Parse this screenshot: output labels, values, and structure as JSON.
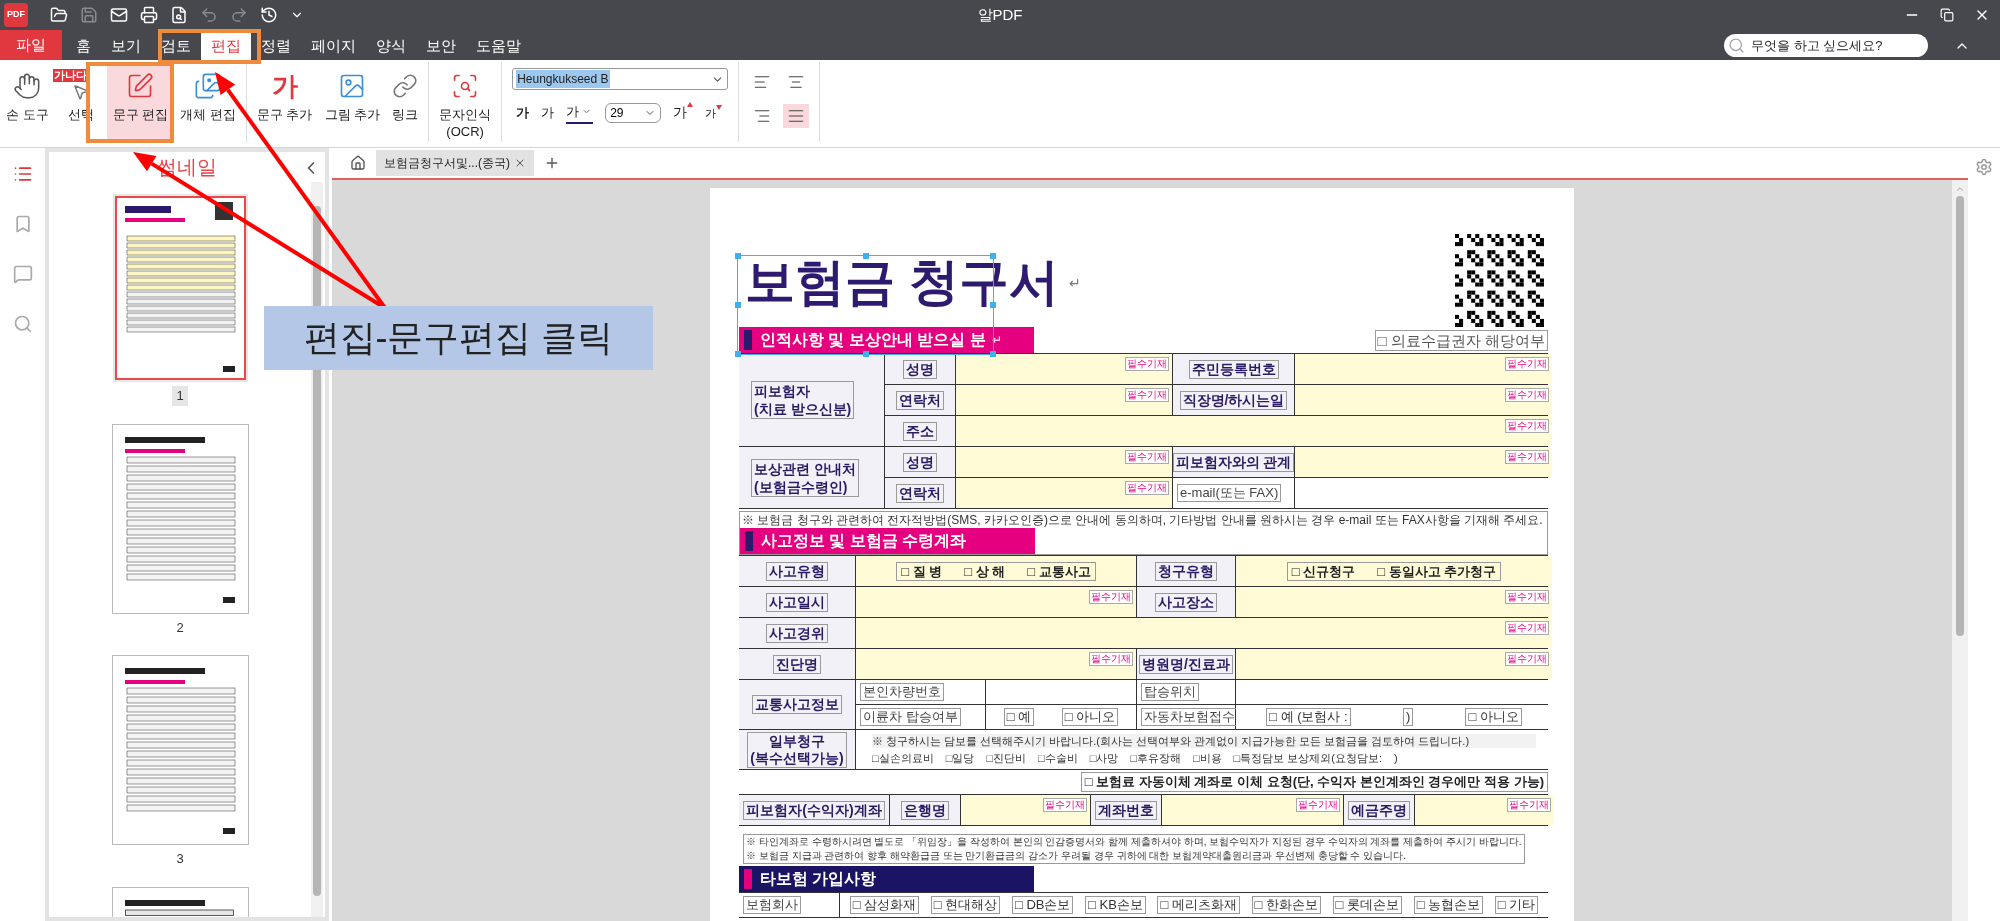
{
  "app": {
    "title": "알PDF",
    "logo": "PDF"
  },
  "quick_access": [
    {
      "kind": "open",
      "disabled": false
    },
    {
      "kind": "save",
      "disabled": true
    },
    {
      "kind": "mail",
      "disabled": false
    },
    {
      "kind": "print",
      "disabled": false
    },
    {
      "kind": "preview",
      "disabled": false
    },
    {
      "kind": "undo",
      "disabled": true
    },
    {
      "kind": "redo",
      "disabled": true
    },
    {
      "kind": "history",
      "disabled": false
    },
    {
      "kind": "more",
      "disabled": false
    }
  ],
  "menu": [
    {
      "kind": "file",
      "label": "파일",
      "selected": false
    },
    {
      "kind": "tab",
      "label": "홈",
      "selected": false
    },
    {
      "kind": "tab",
      "label": "보기",
      "selected": false
    },
    {
      "kind": "tab",
      "label": "검토",
      "selected": false
    },
    {
      "kind": "tab",
      "label": "편집",
      "selected": true
    },
    {
      "kind": "tab",
      "label": "정렬",
      "selected": false
    },
    {
      "kind": "tab",
      "label": "페이지",
      "selected": false
    },
    {
      "kind": "tab",
      "label": "양식",
      "selected": false
    },
    {
      "kind": "tab",
      "label": "보안",
      "selected": false
    },
    {
      "kind": "tab",
      "label": "도움말",
      "selected": false
    }
  ],
  "search": {
    "placeholder": "무엇을 하고 싶으세요?"
  },
  "tools": [
    {
      "kind": "hand",
      "label": "손 도구",
      "selected": false
    },
    {
      "kind": "select",
      "label": "선택",
      "badge": "가나다",
      "selected": false
    },
    {
      "kind": "edit-text",
      "label": "문구 편집",
      "selected": true
    },
    {
      "kind": "edit-object",
      "label": "개체 편집",
      "selected": false
    },
    {
      "kind": "add-text",
      "label": "문구 추가",
      "glyph": "가",
      "selected": false
    },
    {
      "kind": "add-image",
      "label": "그림 추가",
      "selected": false
    },
    {
      "kind": "link",
      "label": "링크",
      "selected": false
    },
    {
      "kind": "ocr",
      "lines": [
        "문자인식",
        "(OCR)"
      ],
      "selected": false
    }
  ],
  "font": {
    "family": "Heungkukseed B",
    "size": "29",
    "styles": [
      {
        "kind": "bold",
        "glyph": "가"
      },
      {
        "kind": "regular",
        "glyph": "가"
      },
      {
        "kind": "color",
        "glyph": "가"
      }
    ],
    "size_buttons": [
      {
        "kind": "grow",
        "glyph": "가"
      },
      {
        "kind": "shrink",
        "glyph": "가"
      }
    ]
  },
  "align": [
    {
      "kind": "left",
      "selected": false
    },
    {
      "kind": "center",
      "selected": false
    },
    {
      "kind": "right",
      "selected": false
    },
    {
      "kind": "justify",
      "selected": true
    }
  ],
  "sidebar_icons": [
    {
      "kind": "thumbnails",
      "selected": true
    },
    {
      "kind": "bookmarks",
      "selected": false
    },
    {
      "kind": "comments",
      "selected": false
    },
    {
      "kind": "search",
      "selected": false
    }
  ],
  "thumbnails": {
    "title": "썸네일",
    "pages": [
      {
        "label": "1",
        "selected": true
      },
      {
        "label": "2",
        "selected": false
      },
      {
        "label": "3",
        "selected": false
      },
      {
        "selected": false
      }
    ]
  },
  "doc_tabs": [
    {
      "label": "보험금청구서및...(종국)",
      "selected": true
    }
  ],
  "document": {
    "title": "보험금 청구서",
    "title_mark": "↵",
    "blocks": [
      {
        "kind": "heading",
        "text": "인적사항 및 보상안내 받으실 분",
        "mark": "↵",
        "color": "#e4007f",
        "marker": {
          "color": "#2b1a6b"
        },
        "aside": "□ 의료수급권자 해당여부"
      },
      {
        "kind": "personal-table",
        "rows": [
          {
            "kind": "field",
            "cells": [
              {
                "kind": "group",
                "lines": [
                  "피보험자",
                  "(치료 받으신분)"
                ],
                "rowspan": 3
              },
              {
                "kind": "label",
                "text": "성명"
              },
              {
                "kind": "input",
                "required": "필수기재"
              },
              {
                "kind": "label",
                "text": "주민등록번호"
              },
              {
                "kind": "input",
                "required": "필수기재"
              }
            ]
          },
          {
            "kind": "field",
            "cells": [
              {
                "kind": "label",
                "text": "연락처"
              },
              {
                "kind": "input",
                "required": "필수기재"
              },
              {
                "kind": "label",
                "text": "직장명/하시는일"
              },
              {
                "kind": "input",
                "required": "필수기재"
              }
            ]
          },
          {
            "kind": "field",
            "cells": [
              {
                "kind": "label",
                "text": "주소"
              },
              {
                "kind": "input",
                "required": "필수기재",
                "colspan": 3
              }
            ]
          },
          {
            "kind": "field",
            "cells": [
              {
                "kind": "group",
                "lines": [
                  "보상관련 안내처",
                  "(보험금수령인)"
                ],
                "rowspan": 2
              },
              {
                "kind": "label",
                "text": "성명"
              },
              {
                "kind": "input",
                "required": "필수기재"
              },
              {
                "kind": "label",
                "text": "피보험자와의 관계"
              },
              {
                "kind": "input",
                "required": "필수기재"
              }
            ]
          },
          {
            "kind": "field",
            "cells": [
              {
                "kind": "label",
                "text": "연락처"
              },
              {
                "kind": "input",
                "required": "필수기재"
              },
              {
                "kind": "hint",
                "text": "e-mail(또는 FAX)"
              },
              {
                "kind": "blank"
              }
            ]
          }
        ]
      },
      {
        "kind": "note",
        "text": "※ 보험금 청구와 관련하여 전자적방법(SMS, 카카오인증)으로 안내에 동의하며, 기타방법 안내를 원하시는 경우 e-mail 또는 FAX사항을 기재해 주세요.",
        "heading": {
          "text": "사고정보 및 보험금 수령계좌",
          "color": "#e4007f",
          "marker": {
            "color": "#2b1a6b"
          }
        }
      },
      {
        "kind": "accident-table",
        "rows": [
          {
            "kind": "field",
            "cells": [
              {
                "kind": "label",
                "text": "사고유형"
              },
              {
                "kind": "options",
                "options": [
                  "□ 질 병",
                  "□ 상 해",
                  "□ 교통사고"
                ],
                "colspan": 2
              },
              {
                "kind": "label",
                "text": "청구유형"
              },
              {
                "kind": "options",
                "options": [
                  "□ 신규청구",
                  "□ 동일사고 추가청구"
                ]
              }
            ]
          },
          {
            "kind": "field",
            "cells": [
              {
                "kind": "label",
                "text": "사고일시"
              },
              {
                "kind": "input",
                "required": "필수기재",
                "colspan": 2
              },
              {
                "kind": "label",
                "text": "사고장소"
              },
              {
                "kind": "input",
                "required": "필수기재"
              }
            ]
          },
          {
            "kind": "field",
            "cells": [
              {
                "kind": "label",
                "text": "사고경위"
              },
              {
                "kind": "input",
                "required": "필수기재",
                "colspan": 4
              }
            ]
          },
          {
            "kind": "field",
            "cells": [
              {
                "kind": "label",
                "text": "진단명"
              },
              {
                "kind": "input",
                "required": "필수기재",
                "colspan": 2
              },
              {
                "kind": "label",
                "text": "병원명/진료과"
              },
              {
                "kind": "input",
                "required": "필수기재"
              }
            ]
          },
          {
            "kind": "sub",
            "cells": [
              {
                "kind": "label",
                "text": "교통사고정보",
                "rowspan": 2
              },
              {
                "kind": "hint",
                "text": "본인차량번호"
              },
              {
                "kind": "blank"
              },
              {
                "kind": "hint",
                "text": "탑승위치"
              },
              {
                "kind": "blank"
              }
            ]
          },
          {
            "kind": "sub",
            "cells": [
              {
                "kind": "hint",
                "text": "이륜차 탑승여부"
              },
              {
                "kind": "choice",
                "options": [
                  "□ 예",
                  "□ 아니오"
                ]
              },
              {
                "kind": "hint",
                "text": "자동차보험접수"
              },
              {
                "kind": "choice",
                "options": [
                  "□ 예 (보험사 :",
                  ")",
                  "□ 아니오"
                ]
              }
            ]
          },
          {
            "kind": "notice",
            "cells": [
              {
                "kind": "label",
                "lines": [
                  "일부청구",
                  "(복수선택가능)"
                ]
              },
              {
                "kind": "notice",
                "colspan": 4,
                "text": "※ 청구하시는 담보를 선택해주시기 바랍니다.(회사는 선택여부와 관계없이 지급가능한 모든 보험금을 검토하여 드립니다.)",
                "options": [
                  "□실손의료비",
                  "□일당",
                  "□진단비",
                  "□수술비",
                  "□사망",
                  "□후유장해",
                  "□비용",
                  "□특정담보 보상제외(요청담보:",
                  ")"
                ]
              }
            ]
          }
        ]
      },
      {
        "kind": "autopay",
        "text": "□ 보험료 자동이체 계좌로 이체 요청(단, 수익자 본인계좌인 경우에만 적용 가능)"
      },
      {
        "kind": "account-table",
        "rows": [
          {
            "kind": "field",
            "cells": [
              {
                "kind": "label",
                "text": "피보험자(수익자)계좌"
              },
              {
                "kind": "label",
                "text": "은행명"
              },
              {
                "kind": "input",
                "required": "필수기재"
              },
              {
                "kind": "label",
                "text": "계좌번호"
              },
              {
                "kind": "input",
                "required": "필수기재"
              },
              {
                "kind": "label",
                "text": "예금주명"
              },
              {
                "kind": "input",
                "required": "필수기재"
              }
            ]
          }
        ]
      },
      {
        "kind": "notes",
        "lines": [
          "※ 타인계좌로 수령하시려면 별도로 「위임장」을 작성하여 본인의 인감증명서와 함께 제출하셔야 하며, 보험수익자가 지정된 경우 수익자의 계좌를 제출하여 주시기 바랍니다.",
          "※ 보험금 지급과 관련하여 향후 해약환급금 또는 만기환급금의 감소가 우려될 경우 귀하에 대한 보험계약대출원리금과 우선변제 충당할 수 있습니다."
        ]
      },
      {
        "kind": "heading",
        "text": "타보험 가입사항",
        "color": "#1b1464",
        "marker": {
          "color": "#e4007f"
        }
      },
      {
        "kind": "other-table",
        "rows": [
          {
            "kind": "sub",
            "cells": [
              {
                "kind": "hint",
                "text": "보험회사"
              },
              {
                "kind": "choice",
                "options": [
                  "□ 삼성화재",
                  "□ 현대해상",
                  "□ DB손보",
                  "□ KB손보",
                  "□ 메리츠화재",
                  "□ 한화손보",
                  "□ 롯데손보",
                  "□ 농협손보",
                  "□ 기타"
                ]
              }
            ]
          }
        ]
      }
    ]
  },
  "annotation": {
    "label": "편집-문구편집 클릭"
  }
}
